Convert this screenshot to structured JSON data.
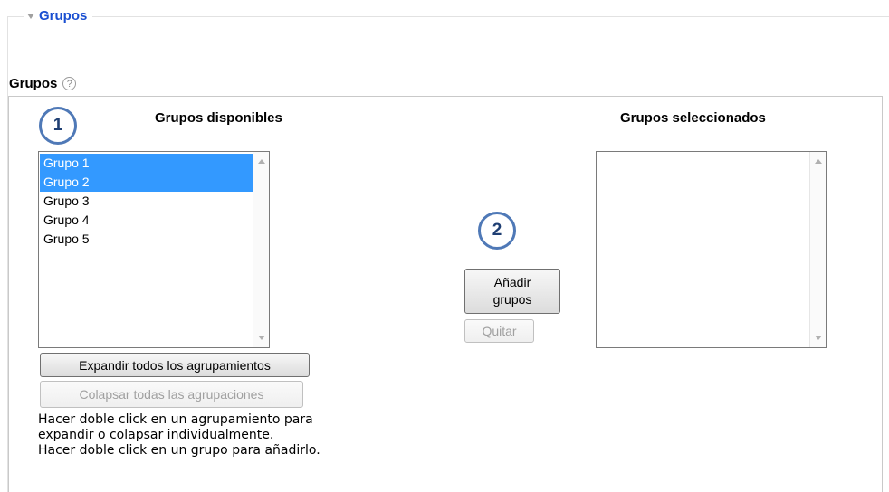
{
  "fieldset": {
    "legend": "Grupos"
  },
  "field": {
    "label": "Grupos",
    "help_glyph": "?"
  },
  "available": {
    "title": "Grupos disponibles",
    "items": [
      {
        "label": "Grupo 1",
        "selected": true
      },
      {
        "label": "Grupo 2",
        "selected": true
      },
      {
        "label": "Grupo 3",
        "selected": false
      },
      {
        "label": "Grupo 4",
        "selected": false
      },
      {
        "label": "Grupo 5",
        "selected": false
      }
    ]
  },
  "selected_list": {
    "title": "Grupos seleccionados",
    "items": []
  },
  "buttons": {
    "add_line1": "Añadir",
    "add_line2": "grupos",
    "remove": "Quitar",
    "expand_all": "Expandir todos los agrupamientos",
    "collapse_all": "Colapsar todas las agrupaciones"
  },
  "hint_lines": [
    "Hacer doble click en un agrupamiento para",
    "expandir o colapsar individualmente.",
    "Hacer doble click en un grupo para añadirlo."
  ],
  "markers": [
    "1",
    "2"
  ],
  "colors": {
    "legend": "#1a4fd1",
    "selection": "#3399ff",
    "marker_border": "#4f79b7"
  }
}
